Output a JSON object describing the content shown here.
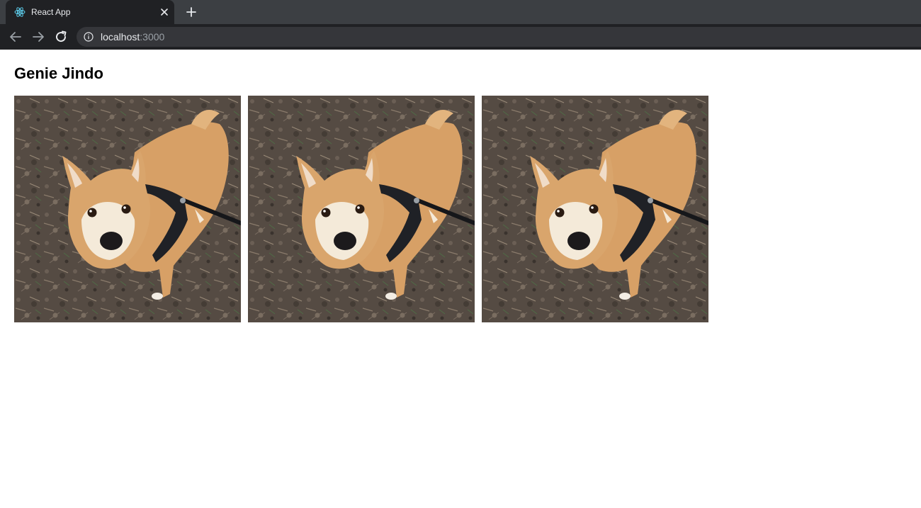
{
  "browser": {
    "tab": {
      "title": "React App",
      "favicon": "react-logo-icon"
    },
    "new_tab_icon": "plus-icon",
    "address": {
      "host": "localhost",
      "port": ":3000"
    }
  },
  "page": {
    "title": "Genie Jindo",
    "photos": [
      {
        "subject": "dog-photo"
      },
      {
        "subject": "dog-photo"
      },
      {
        "subject": "dog-photo"
      }
    ]
  },
  "colors": {
    "chrome_dark": "#202124",
    "tabstrip": "#3c3f43",
    "fur": "#d9a56c",
    "ground": "#5a5048"
  }
}
